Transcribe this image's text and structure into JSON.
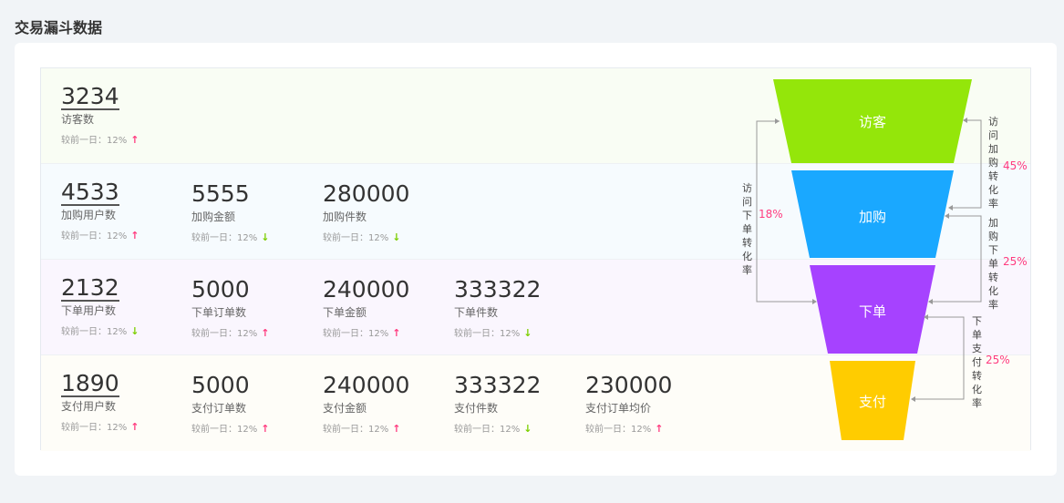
{
  "page_title": "交易漏斗数据",
  "compare_prefix": "较前一日：",
  "rows": [
    {
      "metrics": [
        {
          "value": "3234",
          "label": "访客数",
          "change": "12%",
          "trend": "up",
          "underline": true
        }
      ]
    },
    {
      "metrics": [
        {
          "value": "4533",
          "label": "加购用户数",
          "change": "12%",
          "trend": "up",
          "underline": true
        },
        {
          "value": "5555",
          "label": "加购金额",
          "change": "12%",
          "trend": "down",
          "underline": false
        },
        {
          "value": "280000",
          "label": "加购件数",
          "change": "12%",
          "trend": "down",
          "underline": false
        }
      ]
    },
    {
      "metrics": [
        {
          "value": "2132",
          "label": "下单用户数",
          "change": "12%",
          "trend": "down",
          "underline": true
        },
        {
          "value": "5000",
          "label": "下单订单数",
          "change": "12%",
          "trend": "up",
          "underline": false
        },
        {
          "value": "240000",
          "label": "下单金额",
          "change": "12%",
          "trend": "up",
          "underline": false
        },
        {
          "value": "333322",
          "label": "下单件数",
          "change": "12%",
          "trend": "down",
          "underline": false
        }
      ]
    },
    {
      "metrics": [
        {
          "value": "1890",
          "label": "支付用户数",
          "change": "12%",
          "trend": "up",
          "underline": true
        },
        {
          "value": "5000",
          "label": "支付订单数",
          "change": "12%",
          "trend": "up",
          "underline": false
        },
        {
          "value": "240000",
          "label": "支付金额",
          "change": "12%",
          "trend": "up",
          "underline": false
        },
        {
          "value": "333322",
          "label": "支付件数",
          "change": "12%",
          "trend": "down",
          "underline": false
        },
        {
          "value": "230000",
          "label": "支付订单均价",
          "change": "12%",
          "trend": "up",
          "underline": false
        }
      ]
    }
  ],
  "funnel": {
    "stages": [
      {
        "name": "访客",
        "color": "#94e60a"
      },
      {
        "name": "加购",
        "color": "#1aa8ff"
      },
      {
        "name": "下单",
        "color": "#a642ff"
      },
      {
        "name": "支付",
        "color": "#ffcc00"
      }
    ],
    "conversions": [
      {
        "label": "访问加购转化率",
        "rate": "45%"
      },
      {
        "label": "加购下单转化率",
        "rate": "25%"
      },
      {
        "label": "下单支付转化率",
        "rate": "25%"
      },
      {
        "label": "访问下单转化率",
        "rate": "18%"
      }
    ]
  },
  "colors": {
    "trend_up": "#ff3b7f",
    "trend_down": "#7ccf00",
    "rate": "#ff3b7f"
  }
}
